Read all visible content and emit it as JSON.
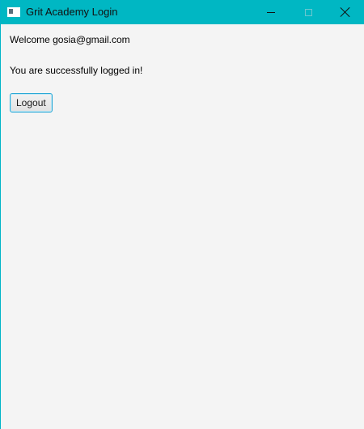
{
  "window": {
    "title": "Grit Academy Login",
    "icon": "java-app-icon",
    "controls": [
      "minimize-icon",
      "maximize-icon",
      "close-icon"
    ]
  },
  "main": {
    "welcome_text": "Welcome gosia@gmail.com",
    "status_text": "You are successfully logged in!",
    "logout_label": "Logout"
  },
  "colors": {
    "titlebar": "#00b7c3",
    "background": "#f4f4f4",
    "button_border": "#2aa9d6"
  }
}
